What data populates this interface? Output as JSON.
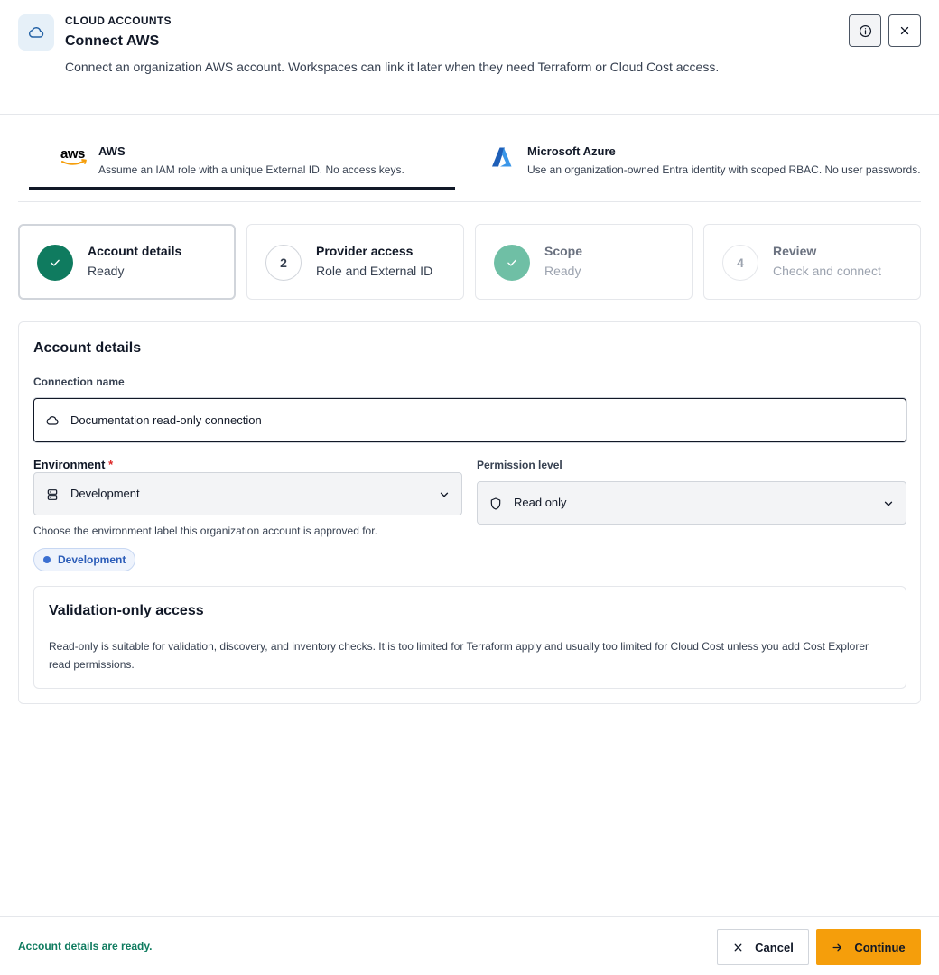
{
  "header": {
    "eyebrow": "CLOUD ACCOUNTS",
    "title": "Connect AWS",
    "subtitle": "Connect an organization AWS account. Workspaces can link it later when they need Terraform or Cloud Cost access.",
    "icon": "cloud-icon",
    "info_icon": "info-icon",
    "close_icon": "close-icon"
  },
  "provider_tabs": [
    {
      "name": "AWS",
      "logo_text": "aws",
      "description": "Assume an IAM role with a unique External ID. No access keys.",
      "selected": true
    },
    {
      "name": "Microsoft Azure",
      "description": "Use an organization-owned Entra identity with scoped RBAC. No user passwords.",
      "selected": false
    }
  ],
  "steps": [
    {
      "badge": "",
      "state": "complete",
      "title": "Account details",
      "subtitle": "Ready",
      "active": true
    },
    {
      "badge": "2",
      "state": "pending",
      "title": "Provider access",
      "subtitle": "Role and External ID",
      "active": false
    },
    {
      "badge": "",
      "state": "complete",
      "title": "Scope",
      "subtitle": "Ready",
      "active": false
    },
    {
      "badge": "4",
      "state": "pending",
      "title": "Review",
      "subtitle": "Check and connect",
      "active": false
    }
  ],
  "panel": {
    "title": "Account details",
    "connection_name": {
      "label": "Connection name",
      "value": "Documentation read-only connection"
    },
    "environment": {
      "label": "Environment",
      "required_marker": "*",
      "value": "Development",
      "helper": "Choose the environment label this organization account is approved for.",
      "chip": "Development"
    },
    "permission_level": {
      "label": "Permission level",
      "value": "Read only"
    },
    "callout": {
      "title": "Validation-only access",
      "body": "Read-only is suitable for validation, discovery, and inventory checks. It is too limited for Terraform apply and usually too limited for Cloud Cost unless you add Cost Explorer read permissions."
    }
  },
  "footer": {
    "status": "Account details are ready.",
    "cancel_label": "Cancel",
    "continue_label": "Continue"
  },
  "colors": {
    "accent": "#f59e0b",
    "success": "#0f7b5f",
    "chip": "#2b5cb8"
  }
}
